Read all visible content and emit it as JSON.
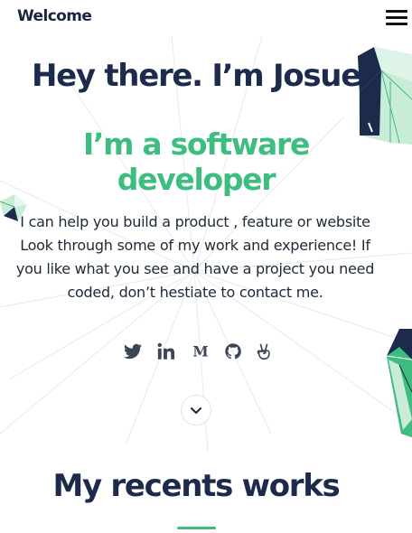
{
  "header": {
    "brand": "Welcome",
    "menu_icon": "hamburger-menu-icon"
  },
  "hero": {
    "greeting": "Hey there. I’m Josue",
    "role": "I’m a software developer",
    "description": "I can help you build a product , feature or website Look through some of my work and experience! If you like what you see and have a project you need coded, don’t hestiate to contact me."
  },
  "socials": [
    {
      "icon": "twitter-icon"
    },
    {
      "icon": "linkedin-icon"
    },
    {
      "icon": "medium-icon"
    },
    {
      "icon": "github-icon"
    },
    {
      "icon": "angellist-icon"
    }
  ],
  "scroll_icon": "chevron-down-icon",
  "works": {
    "title": "My recents works"
  },
  "colors": {
    "navy": "#1c2a4c",
    "accent_green": "#3dbd80",
    "icon_gray": "#3b4656",
    "light_mint": "#c9ecd8"
  }
}
